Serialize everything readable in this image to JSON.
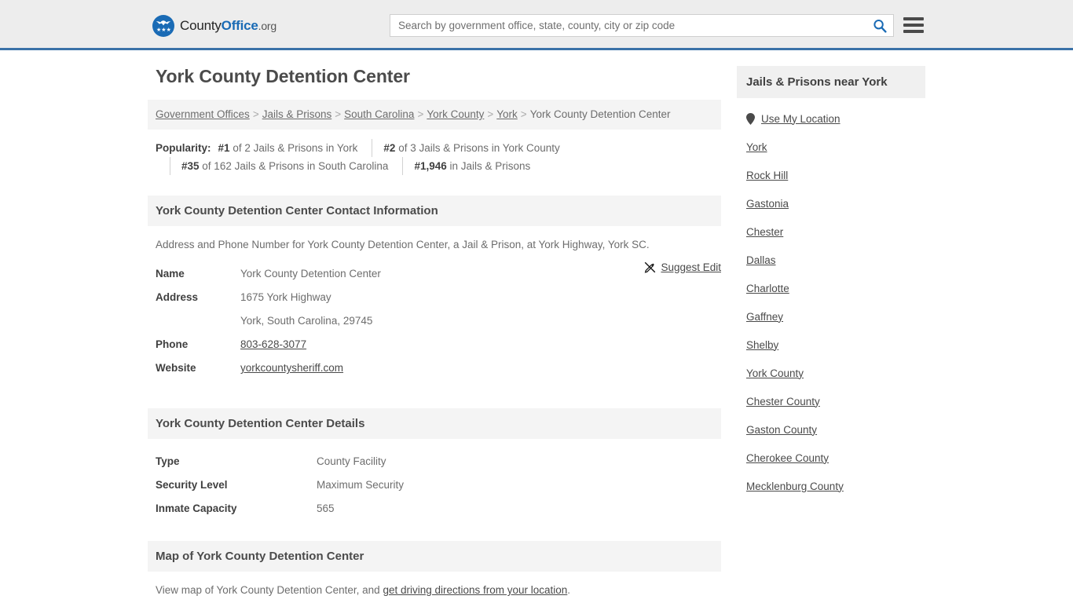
{
  "header": {
    "logo": {
      "part1": "County",
      "part2": "Office",
      "part3": ".org",
      "icon": "eagle-shield-icon"
    },
    "search": {
      "placeholder": "Search by government office, state, county, city or zip code",
      "value": "",
      "icon": "search-icon"
    },
    "menu_icon": "hamburger-menu-icon",
    "accent_color": "#3a72a8",
    "background_color": "#ededed"
  },
  "page_title": "York County Detention Center",
  "breadcrumb": {
    "separator": ">",
    "items": [
      {
        "label": "Government Offices",
        "is_link": true
      },
      {
        "label": "Jails & Prisons",
        "is_link": true
      },
      {
        "label": "South Carolina",
        "is_link": true
      },
      {
        "label": "York County",
        "is_link": true
      },
      {
        "label": "York",
        "is_link": true
      },
      {
        "label": "York County Detention Center",
        "is_link": false
      }
    ]
  },
  "popularity": {
    "label": "Popularity:",
    "items": [
      {
        "rank": "#1",
        "text": "of 2 Jails & Prisons in York"
      },
      {
        "rank": "#2",
        "text": "of 3 Jails & Prisons in York County"
      },
      {
        "rank": "#35",
        "text": "of 162 Jails & Prisons in South Carolina"
      },
      {
        "rank": "#1,946",
        "text": "in Jails & Prisons"
      }
    ]
  },
  "contact_section": {
    "heading": "York County Detention Center Contact Information",
    "description": "Address and Phone Number for York County Detention Center, a Jail & Prison, at York Highway, York SC.",
    "suggest_edit": {
      "label": "Suggest Edit",
      "icon": "edit-pencil-slash-icon"
    },
    "rows": [
      {
        "label": "Name",
        "value": "York County Detention Center",
        "is_link": false
      },
      {
        "label": "Address",
        "value": "1675 York Highway",
        "is_link": false
      },
      {
        "label": "",
        "value": "York, South Carolina, 29745",
        "is_link": false
      },
      {
        "label": "Phone",
        "value": "803-628-3077",
        "is_link": true
      },
      {
        "label": "Website",
        "value": "yorkcountysheriff.com",
        "is_link": true
      }
    ]
  },
  "details_section": {
    "heading": "York County Detention Center Details",
    "rows": [
      {
        "label": "Type",
        "value": "County Facility"
      },
      {
        "label": "Security Level",
        "value": "Maximum Security"
      },
      {
        "label": "Inmate Capacity",
        "value": "565"
      }
    ]
  },
  "map_section": {
    "heading": "Map of York County Detention Center",
    "text_before": "View map of York County Detention Center, and ",
    "link": "get driving directions from your location",
    "text_after": "."
  },
  "sidebar": {
    "heading": "Jails & Prisons near York",
    "use_my_location": {
      "label": "Use My Location",
      "icon": "map-pin-icon"
    },
    "items": [
      {
        "label": "York"
      },
      {
        "label": "Rock Hill"
      },
      {
        "label": "Gastonia"
      },
      {
        "label": "Chester"
      },
      {
        "label": "Dallas"
      },
      {
        "label": "Charlotte"
      },
      {
        "label": "Gaffney"
      },
      {
        "label": "Shelby"
      },
      {
        "label": "York County"
      },
      {
        "label": "Chester County"
      },
      {
        "label": "Gaston County"
      },
      {
        "label": "Cherokee County"
      },
      {
        "label": "Mecklenburg County"
      }
    ]
  }
}
